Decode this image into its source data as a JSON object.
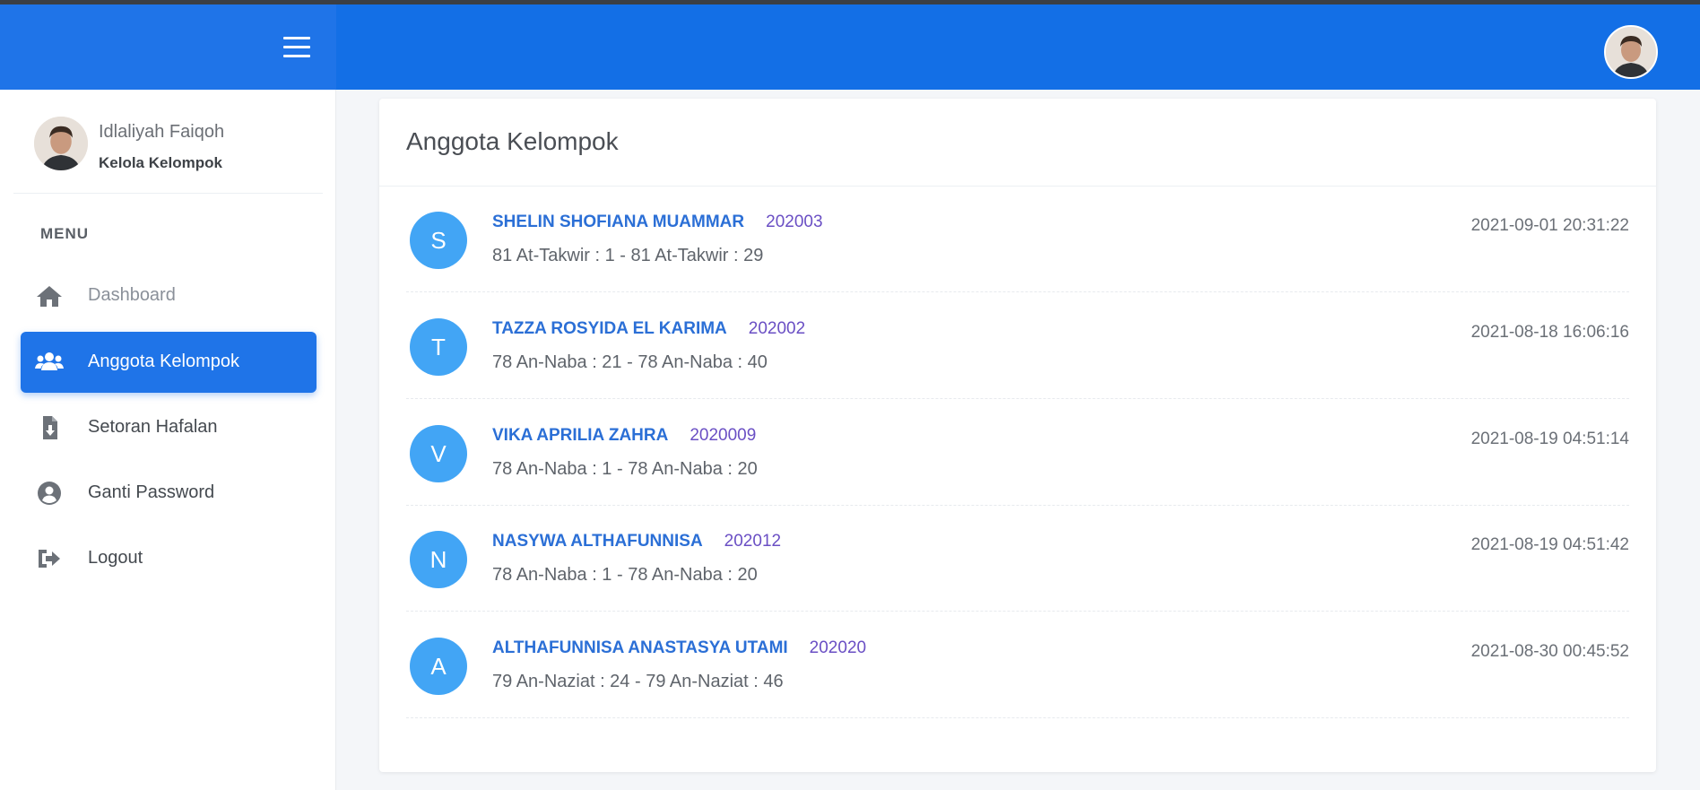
{
  "sidebar": {
    "user": {
      "name": "Idlaliyah Faiqoh",
      "role": "Kelola Kelompok",
      "avatar_icon": "user-avatar-photo"
    },
    "menu_title": "MENU",
    "items": [
      {
        "label": "Dashboard",
        "icon": "home-icon",
        "active": false
      },
      {
        "label": "Anggota Kelompok",
        "icon": "users-icon",
        "active": true
      },
      {
        "label": "Setoran Hafalan",
        "icon": "file-download-icon",
        "active": false
      },
      {
        "label": "Ganti Password",
        "icon": "user-circle-icon",
        "active": false
      },
      {
        "label": "Logout",
        "icon": "sign-out-icon",
        "active": false
      }
    ]
  },
  "header": {
    "menu_icon": "hamburger-icon",
    "avatar_icon": "user-avatar-photo"
  },
  "main": {
    "title": "Anggota Kelompok",
    "members": [
      {
        "initial": "S",
        "name": "SHELIN SHOFIANA MUAMMAR",
        "id": "202003",
        "range": "81 At-Takwir : 1 - 81 At-Takwir : 29",
        "time": "2021-09-01 20:31:22"
      },
      {
        "initial": "T",
        "name": "TAZZA ROSYIDA EL KARIMA",
        "id": "202002",
        "range": "78 An-Naba : 21 - 78 An-Naba : 40",
        "time": "2021-08-18 16:06:16"
      },
      {
        "initial": "V",
        "name": "VIKA APRILIA ZAHRA",
        "id": "2020009",
        "range": "78 An-Naba : 1 - 78 An-Naba : 20",
        "time": "2021-08-19 04:51:14"
      },
      {
        "initial": "N",
        "name": "NASYWA ALTHAFUNNISA",
        "id": "202012",
        "range": "78 An-Naba : 1 - 78 An-Naba : 20",
        "time": "2021-08-19 04:51:42"
      },
      {
        "initial": "A",
        "name": "ALTHAFUNNISA ANASTASYA UTAMI",
        "id": "202020",
        "range": "79 An-Naziat : 24 - 79 An-Naziat : 46",
        "time": "2021-08-30 00:45:52"
      }
    ]
  },
  "colors": {
    "primary": "#1f74e8",
    "avatar_initial_bg": "#42a5f5",
    "name_link": "#2b6fd6",
    "id_text": "#6a4fc4"
  }
}
